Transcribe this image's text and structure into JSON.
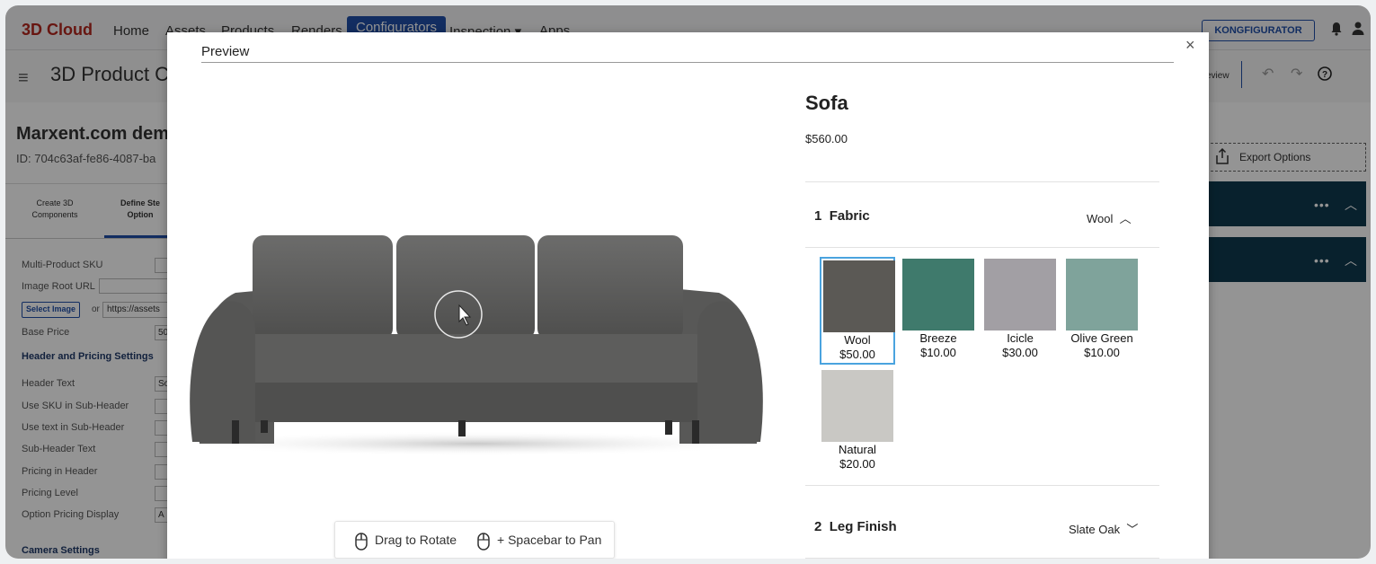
{
  "app": {
    "brand": "3D Cloud",
    "nav": [
      "Home",
      "Assets",
      "Products",
      "Renders",
      "Configurators",
      "Inspection",
      "Apps"
    ],
    "nav_active": "Configurators",
    "inspection_caret": "▾",
    "konfigurator_label": "KONGFIGURATOR",
    "page_title": "3D Product Co",
    "preview_link": "eview",
    "company": "Marxent.com demo",
    "product_id": "ID: 704c63af-fe86-4087-ba",
    "steps": [
      "Create 3D Components",
      "Define Ste Option"
    ],
    "fields": {
      "multi_sku": "Multi-Product SKU",
      "image_root": "Image Root URL",
      "select_image": "Select Image",
      "or": "or",
      "url_value": "https://assets",
      "base_price": "Base Price",
      "base_price_value": "50",
      "header_section": "Header and Pricing Settings",
      "header_text": "Header Text",
      "header_text_value": "So",
      "use_sku": "Use SKU in Sub-Header",
      "use_text": "Use text in Sub-Header",
      "subheader_text": "Sub-Header Text",
      "pricing_header": "Pricing in Header",
      "pricing_level": "Pricing Level",
      "option_pricing": "Option Pricing Display",
      "option_pricing_value": "A",
      "camera_section": "Camera Settings"
    },
    "export_label": "Export Options"
  },
  "modal": {
    "title": "Preview",
    "close": "×",
    "hints": {
      "rotate": "Drag to Rotate",
      "pan": "+ Spacebar to Pan"
    },
    "product": {
      "name": "Sofa",
      "price": "$560.00"
    },
    "options": [
      {
        "num": "1",
        "name": "Fabric",
        "value": "Wool",
        "expanded": true
      },
      {
        "num": "2",
        "name": "Leg Finish",
        "value": "Slate Oak",
        "expanded": false
      }
    ],
    "swatches": [
      {
        "name": "Wool",
        "price": "$50.00",
        "color": "#5b5955",
        "selected": true
      },
      {
        "name": "Breeze",
        "price": "$10.00",
        "color": "#3f7a6c",
        "selected": false
      },
      {
        "name": "Icicle",
        "price": "$30.00",
        "color": "#a29fa4",
        "selected": false
      },
      {
        "name": "Olive Green",
        "price": "$10.00",
        "color": "#7fa39b",
        "selected": false
      },
      {
        "name": "Natural",
        "price": "$20.00",
        "color": "#c9c8c4",
        "selected": false
      }
    ]
  }
}
